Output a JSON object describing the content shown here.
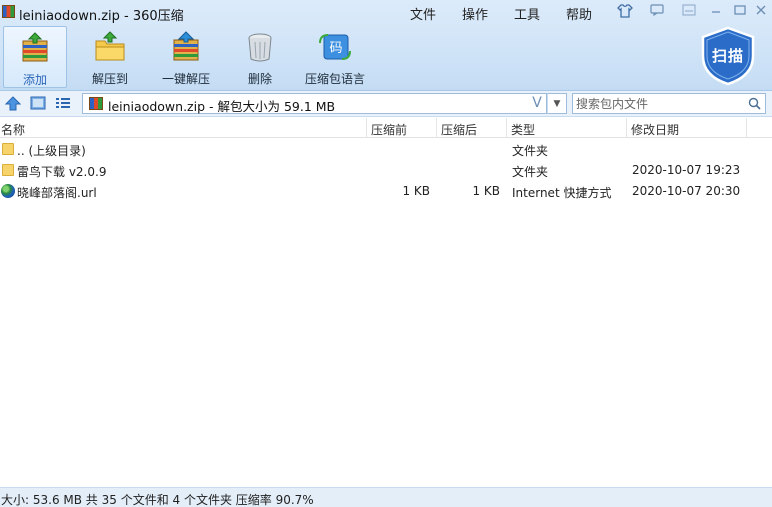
{
  "window": {
    "title": "leiniaodown.zip - 360压缩",
    "menus": [
      "文件",
      "操作",
      "工具",
      "帮助"
    ]
  },
  "toolbar": {
    "add": "添加",
    "extract_to": "解压到",
    "one_click_extract": "一键解压",
    "delete": "删除",
    "archive_language": "压缩包语言",
    "scan": "扫描",
    "archive_language_icon_text": "码"
  },
  "address": {
    "path": "leiniaodown.zip - 解包大小为 59.1 MB",
    "search_placeholder": "搜索包内文件"
  },
  "columns": {
    "name": "名称",
    "compressed": "压缩前",
    "after": "压缩后",
    "type": "类型",
    "modified": "修改日期"
  },
  "files": [
    {
      "name": ".. (上级目录)",
      "before": "",
      "after": "",
      "type": "文件夹",
      "modified": "",
      "icon": "folder-icon"
    },
    {
      "name": "雷鸟下载 v2.0.9",
      "before": "",
      "after": "",
      "type": "文件夹",
      "modified": "2020-10-07 19:23",
      "icon": "folder-icon"
    },
    {
      "name": "晓峰部落阁.url",
      "before": "1 KB",
      "after": "1 KB",
      "type": "Internet 快捷方式",
      "modified": "2020-10-07 20:30",
      "icon": "globe-icon"
    }
  ],
  "status": {
    "text": "大小: 53.6 MB 共 35 个文件和 4 个文件夹 压缩率 90.7%"
  },
  "colors": {
    "accent": "#2b66b8",
    "toolbar_bg": "#cfe3f7",
    "shield": "#2a6cc8"
  }
}
